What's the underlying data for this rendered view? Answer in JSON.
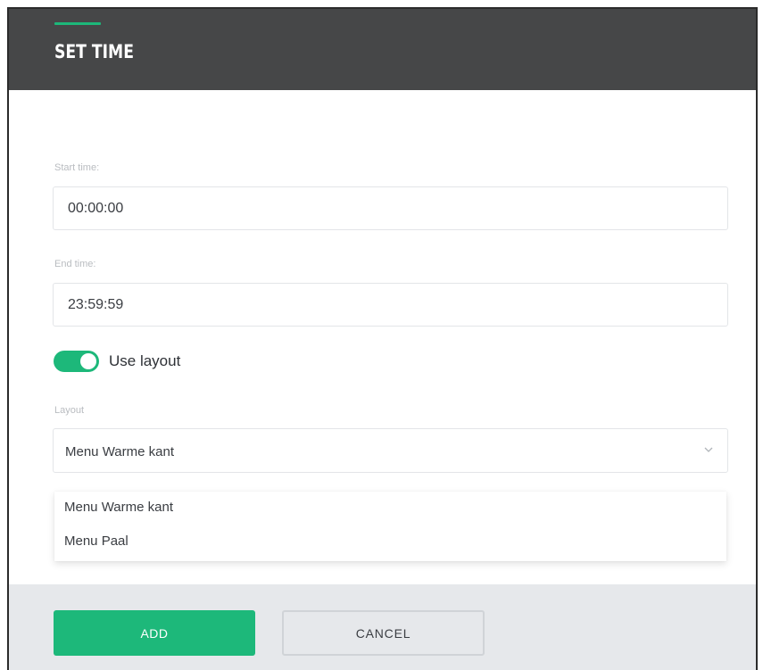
{
  "dialog": {
    "title": "SET TIME"
  },
  "form": {
    "start_time": {
      "label": "Start time:",
      "value": "00:00:00"
    },
    "end_time": {
      "label": "End time:",
      "value": "23:59:59"
    },
    "use_layout": {
      "label": "Use layout",
      "checked": true
    },
    "layout": {
      "label": "Layout",
      "selected": "Menu Warme kant",
      "options": [
        "Menu Warme kant",
        "Menu Paal"
      ]
    }
  },
  "footer": {
    "add_label": "ADD",
    "cancel_label": "CANCEL"
  },
  "colors": {
    "accent": "#1db87a",
    "header_bg": "#464748",
    "footer_bg": "#e6e8eb"
  },
  "icons": {
    "select_arrow": "chevron-down-icon"
  }
}
